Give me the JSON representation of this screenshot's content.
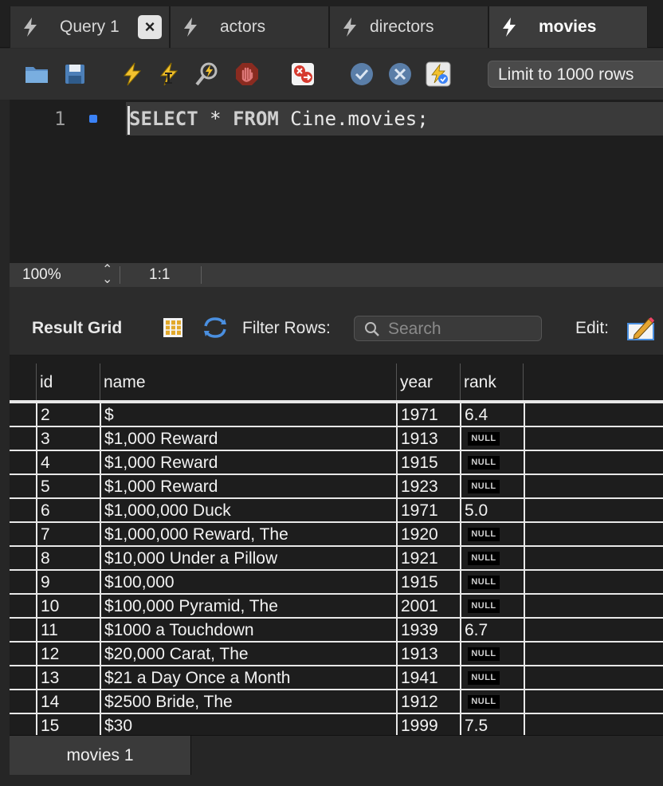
{
  "tabs": [
    {
      "label": "Query 1",
      "active": false,
      "closable": true
    },
    {
      "label": "actors",
      "active": false,
      "closable": false
    },
    {
      "label": "directors",
      "active": false,
      "closable": false
    },
    {
      "label": "movies",
      "active": true,
      "closable": false
    }
  ],
  "toolbar": {
    "limit_label": "Limit to 1000 rows",
    "icons": [
      "open-folder-icon",
      "save-icon",
      "execute-icon",
      "execute-current-icon",
      "explain-icon",
      "stop-icon",
      "toggle-error-icon",
      "commit-icon",
      "rollback-icon",
      "autocommit-icon"
    ]
  },
  "editor": {
    "line_number": "1",
    "code_kw_select": "SELECT",
    "code_star": " * ",
    "code_kw_from": "FROM",
    "code_rest": " Cine.movies;"
  },
  "status": {
    "zoom": "100%",
    "position": "1:1"
  },
  "result": {
    "label": "Result Grid",
    "filter_label": "Filter Rows:",
    "search_placeholder": "Search",
    "edit_label": "Edit:"
  },
  "grid": {
    "columns": [
      "id",
      "name",
      "year",
      "rank"
    ],
    "null_text": "NULL",
    "rows": [
      {
        "id": "2",
        "name": "$",
        "year": "1971",
        "rank": "6.4"
      },
      {
        "id": "3",
        "name": "$1,000 Reward",
        "year": "1913",
        "rank": null
      },
      {
        "id": "4",
        "name": "$1,000 Reward",
        "year": "1915",
        "rank": null
      },
      {
        "id": "5",
        "name": "$1,000 Reward",
        "year": "1923",
        "rank": null
      },
      {
        "id": "6",
        "name": "$1,000,000 Duck",
        "year": "1971",
        "rank": "5.0"
      },
      {
        "id": "7",
        "name": "$1,000,000 Reward, The",
        "year": "1920",
        "rank": null
      },
      {
        "id": "8",
        "name": "$10,000 Under a Pillow",
        "year": "1921",
        "rank": null
      },
      {
        "id": "9",
        "name": "$100,000",
        "year": "1915",
        "rank": null
      },
      {
        "id": "10",
        "name": "$100,000 Pyramid, The",
        "year": "2001",
        "rank": null
      },
      {
        "id": "11",
        "name": "$1000 a Touchdown",
        "year": "1939",
        "rank": "6.7"
      },
      {
        "id": "12",
        "name": "$20,000 Carat, The",
        "year": "1913",
        "rank": null
      },
      {
        "id": "13",
        "name": "$21 a Day Once a Month",
        "year": "1941",
        "rank": null
      },
      {
        "id": "14",
        "name": "$2500 Bride, The",
        "year": "1912",
        "rank": null
      },
      {
        "id": "15",
        "name": "$30",
        "year": "1999",
        "rank": "7.5"
      }
    ]
  },
  "bottom_tab": "movies 1"
}
